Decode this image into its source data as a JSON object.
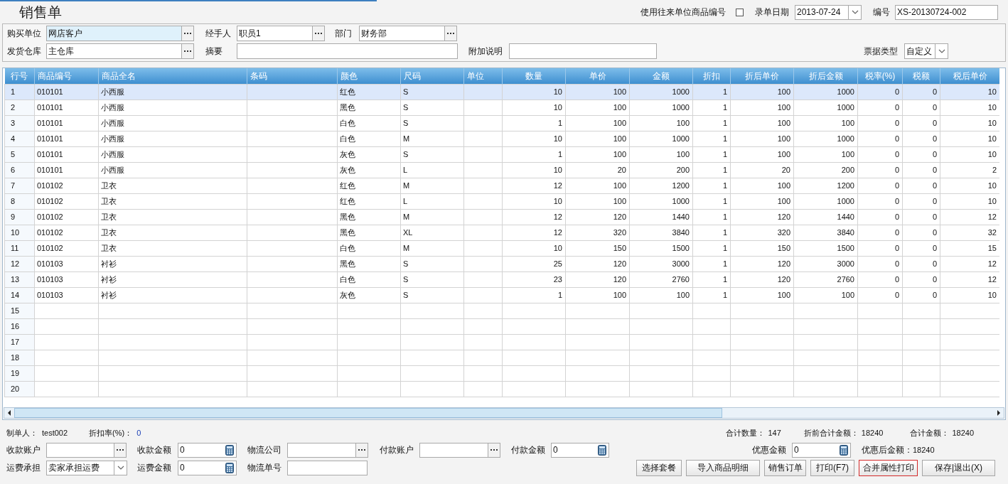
{
  "window": {
    "title": "销售单"
  },
  "header_fields": [
    {
      "kind": "checkbox",
      "label": "使用往来单位商品编号",
      "checked": false
    },
    {
      "kind": "combo",
      "label": "录单日期",
      "value": "2013-07-24"
    },
    {
      "kind": "text",
      "label": "编号",
      "value": "XS-20130724-002"
    }
  ],
  "form_rows": [
    [
      {
        "kind": "lookup",
        "label": "购买单位",
        "value": "网店客户",
        "focused": true
      },
      {
        "kind": "lookup",
        "label": "经手人",
        "value": "职员1",
        "focused": false
      },
      {
        "kind": "lookup",
        "label": "部门",
        "value": "财务部",
        "focused": false
      }
    ],
    [
      {
        "kind": "lookup",
        "label": "发货仓库",
        "value": "主仓库",
        "focused": false
      },
      {
        "kind": "text",
        "label": "摘要",
        "focused": false
      },
      {
        "kind": "text",
        "label": "附加说明",
        "focused": false
      },
      {
        "kind": "combo",
        "label": "票据类型",
        "value": "自定义",
        "focused": false
      }
    ]
  ],
  "table": {
    "columns": [
      {
        "label": "行号",
        "kind": "rowhead"
      },
      {
        "label": "商品编号",
        "kind": "text"
      },
      {
        "label": "商品全名",
        "kind": "text"
      },
      {
        "label": "条码",
        "kind": "text"
      },
      {
        "label": "颜色",
        "kind": "text"
      },
      {
        "label": "尺码",
        "kind": "text"
      },
      {
        "label": "单位",
        "kind": "text"
      },
      {
        "label": "数量",
        "kind": "number"
      },
      {
        "label": "单价",
        "kind": "number"
      },
      {
        "label": "金额",
        "kind": "number"
      },
      {
        "label": "折扣",
        "kind": "number"
      },
      {
        "label": "折后单价",
        "kind": "number"
      },
      {
        "label": "折后金额",
        "kind": "number"
      },
      {
        "label": "税率(%)",
        "kind": "number"
      },
      {
        "label": "税额",
        "kind": "number"
      },
      {
        "label": "税后单价",
        "kind": "number"
      }
    ],
    "rows": [
      {
        "selected": true,
        "cells": [
          "1",
          "010101",
          "小西服",
          null,
          "红色",
          "S",
          null,
          "10",
          "100",
          "1000",
          "1",
          "100",
          "1000",
          "0",
          "0",
          "10"
        ]
      },
      {
        "selected": false,
        "cells": [
          "2",
          "010101",
          "小西服",
          null,
          "黑色",
          "S",
          null,
          "10",
          "100",
          "1000",
          "1",
          "100",
          "1000",
          "0",
          "0",
          "10"
        ]
      },
      {
        "selected": false,
        "cells": [
          "3",
          "010101",
          "小西服",
          null,
          "白色",
          "S",
          null,
          "1",
          "100",
          "100",
          "1",
          "100",
          "100",
          "0",
          "0",
          "10"
        ]
      },
      {
        "selected": false,
        "cells": [
          "4",
          "010101",
          "小西服",
          null,
          "白色",
          "M",
          null,
          "10",
          "100",
          "1000",
          "1",
          "100",
          "1000",
          "0",
          "0",
          "10"
        ]
      },
      {
        "selected": false,
        "cells": [
          "5",
          "010101",
          "小西服",
          null,
          "灰色",
          "S",
          null,
          "1",
          "100",
          "100",
          "1",
          "100",
          "100",
          "0",
          "0",
          "10"
        ]
      },
      {
        "selected": false,
        "cells": [
          "6",
          "010101",
          "小西服",
          null,
          "灰色",
          "L",
          null,
          "10",
          "20",
          "200",
          "1",
          "20",
          "200",
          "0",
          "0",
          "2"
        ]
      },
      {
        "selected": false,
        "cells": [
          "7",
          "010102",
          "卫衣",
          null,
          "红色",
          "M",
          null,
          "12",
          "100",
          "1200",
          "1",
          "100",
          "1200",
          "0",
          "0",
          "10"
        ]
      },
      {
        "selected": false,
        "cells": [
          "8",
          "010102",
          "卫衣",
          null,
          "红色",
          "L",
          null,
          "10",
          "100",
          "1000",
          "1",
          "100",
          "1000",
          "0",
          "0",
          "10"
        ]
      },
      {
        "selected": false,
        "cells": [
          "9",
          "010102",
          "卫衣",
          null,
          "黑色",
          "M",
          null,
          "12",
          "120",
          "1440",
          "1",
          "120",
          "1440",
          "0",
          "0",
          "12"
        ]
      },
      {
        "selected": false,
        "cells": [
          "10",
          "010102",
          "卫衣",
          null,
          "黑色",
          "XL",
          null,
          "12",
          "320",
          "3840",
          "1",
          "320",
          "3840",
          "0",
          "0",
          "32"
        ]
      },
      {
        "selected": false,
        "cells": [
          "11",
          "010102",
          "卫衣",
          null,
          "白色",
          "M",
          null,
          "10",
          "150",
          "1500",
          "1",
          "150",
          "1500",
          "0",
          "0",
          "15"
        ]
      },
      {
        "selected": false,
        "cells": [
          "12",
          "010103",
          "衬衫",
          null,
          "黑色",
          "S",
          null,
          "25",
          "120",
          "3000",
          "1",
          "120",
          "3000",
          "0",
          "0",
          "12"
        ]
      },
      {
        "selected": false,
        "cells": [
          "13",
          "010103",
          "衬衫",
          null,
          "白色",
          "S",
          null,
          "23",
          "120",
          "2760",
          "1",
          "120",
          "2760",
          "0",
          "0",
          "12"
        ]
      },
      {
        "selected": false,
        "cells": [
          "14",
          "010103",
          "衬衫",
          null,
          "灰色",
          "S",
          null,
          "1",
          "100",
          "100",
          "1",
          "100",
          "100",
          "0",
          "0",
          "10"
        ]
      },
      {
        "selected": false,
        "cells": [
          "15"
        ]
      },
      {
        "selected": false,
        "cells": [
          "16"
        ]
      },
      {
        "selected": false,
        "cells": [
          "17"
        ]
      },
      {
        "selected": false,
        "cells": [
          "18"
        ]
      },
      {
        "selected": false,
        "cells": [
          "19"
        ]
      },
      {
        "selected": false,
        "cells": [
          "20"
        ]
      }
    ]
  },
  "summary": [
    {
      "label": "制单人：",
      "value": "test002"
    },
    {
      "label": "折扣率(%)：",
      "value": "0"
    }
  ],
  "totals": [
    {
      "label": "合计数量：",
      "value": "147"
    },
    {
      "label": "折前合计金额：",
      "value": "18240"
    },
    {
      "label": "合计金额：",
      "value": "18240"
    }
  ],
  "payment_rows": [
    [
      {
        "kind": "lookup",
        "label": "收款账户"
      },
      {
        "kind": "calc",
        "label": "收款金额",
        "value": "0"
      },
      {
        "kind": "lookup",
        "label": "物流公司"
      },
      {
        "kind": "lookup",
        "label": "付款账户"
      },
      {
        "kind": "calc",
        "label": "付款金额",
        "value": "0"
      },
      {
        "kind": "calc",
        "label": "优惠金额",
        "value": "0"
      },
      {
        "kind": "readout",
        "label": "优惠后金额：",
        "value": "18240"
      }
    ],
    [
      {
        "kind": "combo",
        "label": "运费承担",
        "value": "卖家承担运费"
      },
      {
        "kind": "calc",
        "label": "运费金额",
        "value": "0"
      },
      {
        "kind": "text",
        "label": "物流单号"
      }
    ]
  ],
  "buttons": [
    {
      "label": "选择套餐",
      "focused": false
    },
    {
      "label": "导入商品明细",
      "focused": false
    },
    {
      "label": "销售订单",
      "focused": false
    },
    {
      "label": "打印(F7)",
      "focused": false
    },
    {
      "label": "合并属性打印",
      "focused": true
    },
    {
      "label": "保存|退出(X)",
      "focused": false
    }
  ]
}
